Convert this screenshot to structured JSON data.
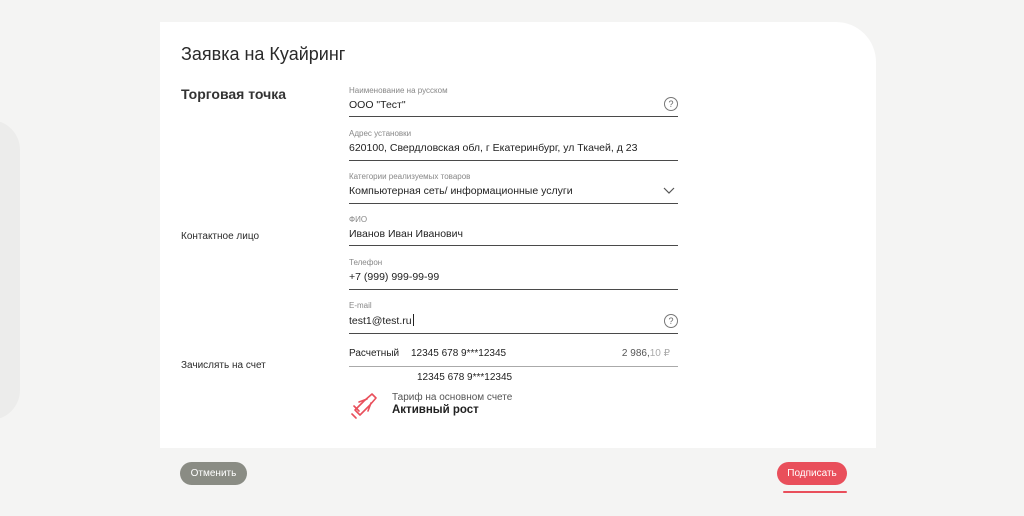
{
  "title": "Заявка на Куайринг",
  "sections": {
    "outlet": "Торговая точка",
    "contact": "Контактное лицо",
    "account": "Зачислять на счет"
  },
  "fields": {
    "name_ru": {
      "label": "Наименование на русском",
      "value": "ООО \"Тест\""
    },
    "address": {
      "label": "Адрес установки",
      "value": "620100, Свердловская обл, г Екатеринбург, ул Ткачей, д 23"
    },
    "category": {
      "label": "Категории реализуемых товаров",
      "value": "Компьютерная сеть/ информационные услуги"
    },
    "fio": {
      "label": "ФИО",
      "value": "Иванов Иван Иванович"
    },
    "phone": {
      "label": "Телефон",
      "value": "+7 (999) 999-99-99"
    },
    "email": {
      "label": "E-mail",
      "value": "test1@test.ru"
    }
  },
  "account": {
    "label": "Расчетный",
    "number": "12345 678 9***12345",
    "balance_main": "2 986,",
    "balance_kop": "10 ₽",
    "sub_number": "12345 678 9***12345"
  },
  "tariff": {
    "label": "Тариф на основном счете",
    "name": "Активный рост"
  },
  "buttons": {
    "cancel": "Отменить",
    "sign": "Подписать"
  },
  "icons": {
    "help": "?"
  },
  "colors": {
    "accent": "#e94f5b",
    "cancel": "#8a8c84"
  }
}
